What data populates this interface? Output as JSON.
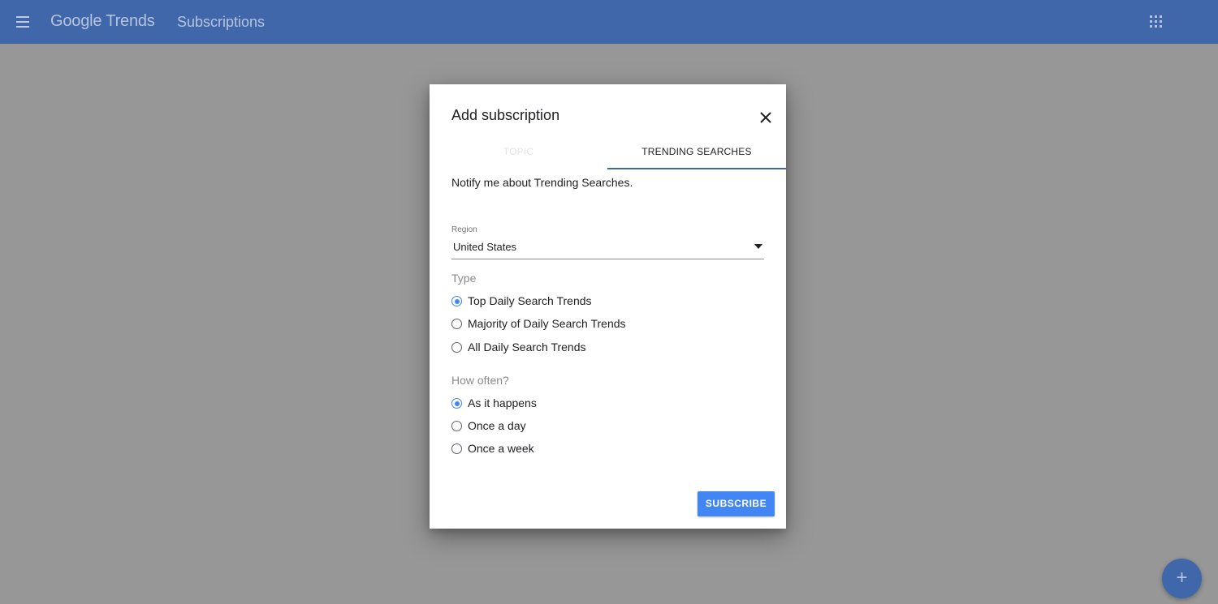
{
  "appbar": {
    "logo_google": "Google",
    "logo_trends": "Trends",
    "section_title": "Subscriptions"
  },
  "dialog": {
    "title": "Add subscription",
    "tabs": [
      {
        "label": "TOPIC",
        "active": false
      },
      {
        "label": "TRENDING SEARCHES",
        "active": true
      }
    ],
    "description": "Notify me about Trending Searches.",
    "region": {
      "label": "Region",
      "value": "United States"
    },
    "type_group": {
      "label": "Type",
      "options": [
        {
          "label": "Top Daily Search Trends",
          "checked": true
        },
        {
          "label": "Majority of Daily Search Trends",
          "checked": false
        },
        {
          "label": "All Daily Search Trends",
          "checked": false
        }
      ]
    },
    "frequency_group": {
      "label": "How often?",
      "options": [
        {
          "label": "As it happens",
          "checked": true
        },
        {
          "label": "Once a day",
          "checked": false
        },
        {
          "label": "Once a week",
          "checked": false
        }
      ]
    },
    "subscribe_label": "SUBSCRIBE"
  },
  "fab": {
    "icon": "plus-icon",
    "glyph": "+"
  },
  "colors": {
    "appbar": "#3f67a9",
    "overlay": "#979797",
    "accent": "#4285f4"
  }
}
